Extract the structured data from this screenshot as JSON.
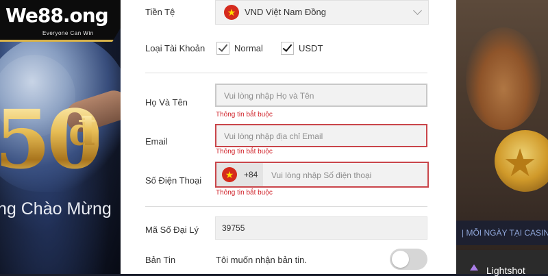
{
  "brand": {
    "logo": "We88.ong",
    "tagline": "Everyone Can Win",
    "accent": "#d7b24a"
  },
  "left_banner": {
    "amount": "50",
    "currency_sign": "đ",
    "welcome": "ng Chào Mừng"
  },
  "right_banner": {
    "ticker": "| MỖI NGÀY TẠI CASINO",
    "lightshot_label": "Lightshot"
  },
  "form": {
    "currency": {
      "label": "Tiền Tệ",
      "value": "VND Việt Nam Đồng",
      "flag": "vietnam-flag-icon"
    },
    "account_type": {
      "label": "Loại Tài Khoản",
      "options": [
        {
          "label": "Normal",
          "checked": true
        },
        {
          "label": "USDT",
          "checked": true
        }
      ]
    },
    "full_name": {
      "label": "Họ Và Tên",
      "placeholder": "Vui lòng nhập Họ và Tên",
      "error": "Thông tin bắt buộc"
    },
    "email": {
      "label": "Email",
      "placeholder": "Vui lòng nhập địa chỉ Email",
      "error": "Thông tin bắt buộc"
    },
    "phone": {
      "label": "Số Điện Thoại",
      "code": "+84",
      "placeholder": "Vui lòng nhập Số điện thoại",
      "error": "Thông tin bắt buộc"
    },
    "agent_code": {
      "label": "Mã Số Đại Lý",
      "value": "39755"
    },
    "newsletter": {
      "label": "Bản Tin",
      "text": "Tôi muốn nhận bản tin.",
      "enabled": false
    }
  },
  "colors": {
    "error": "#d0242b",
    "error_border": "#c9454a",
    "panel": "#ffffff",
    "field": "#f2f2f2"
  }
}
